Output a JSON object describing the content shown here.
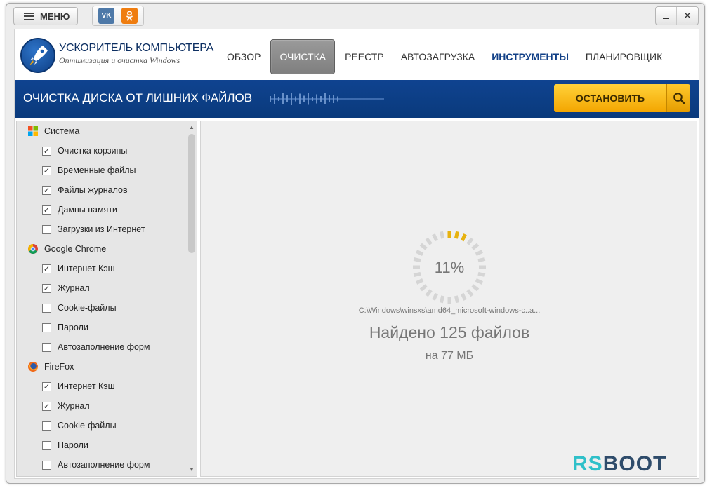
{
  "titlebar": {
    "menu_label": "МЕНЮ",
    "vk_label": "VK",
    "ok_label": "ok"
  },
  "app": {
    "title": "УСКОРИТЕЛЬ КОМПЬЮТЕРА",
    "subtitle": "Оптимизация и очистка Windows"
  },
  "nav": {
    "items": [
      "ОБЗОР",
      "ОЧИСТКА",
      "РЕЕСТР",
      "АВТОЗАГРУЗКА",
      "ИНСТРУМЕНТЫ",
      "ПЛАНИРОВЩИК"
    ],
    "active": "ОЧИСТКА",
    "highlighted": "ИНСТРУМЕНТЫ"
  },
  "banner": {
    "title": "ОЧИСТКА ДИСКА ОТ ЛИШНИХ ФАЙЛОВ",
    "stop_label": "ОСТАНОВИТЬ"
  },
  "sidebar": {
    "groups": [
      {
        "name": "Система",
        "icon": "windows-icon",
        "items": [
          {
            "label": "Очистка корзины",
            "checked": true
          },
          {
            "label": "Временные файлы",
            "checked": true
          },
          {
            "label": "Файлы журналов",
            "checked": true
          },
          {
            "label": "Дампы памяти",
            "checked": true
          },
          {
            "label": "Загрузки из Интернет",
            "checked": false
          }
        ]
      },
      {
        "name": "Google Chrome",
        "icon": "chrome-icon",
        "items": [
          {
            "label": "Интернет Кэш",
            "checked": true
          },
          {
            "label": "Журнал",
            "checked": true
          },
          {
            "label": "Cookie-файлы",
            "checked": false
          },
          {
            "label": "Пароли",
            "checked": false
          },
          {
            "label": "Автозаполнение форм",
            "checked": false
          }
        ]
      },
      {
        "name": "FireFox",
        "icon": "firefox-icon",
        "items": [
          {
            "label": "Интернет Кэш",
            "checked": true
          },
          {
            "label": "Журнал",
            "checked": true
          },
          {
            "label": "Cookie-файлы",
            "checked": false
          },
          {
            "label": "Пароли",
            "checked": false
          },
          {
            "label": "Автозаполнение форм",
            "checked": false
          }
        ]
      }
    ]
  },
  "progress": {
    "percent_text": "11%",
    "fraction": 0.11,
    "current_path": "C:\\Windows\\winsxs\\amd64_microsoft-windows-c..a...",
    "found_text": "Найдено 125 файлов",
    "size_text": "на 77 МБ"
  },
  "watermark": {
    "part1": "RS",
    "part2": "BOOT"
  },
  "colors": {
    "banner": "#0f4390",
    "accent_yellow": "#f3a500",
    "nav_highlight": "#103f86",
    "spinner_active": "#e7b20f",
    "spinner_inactive": "#d5d5d5"
  }
}
